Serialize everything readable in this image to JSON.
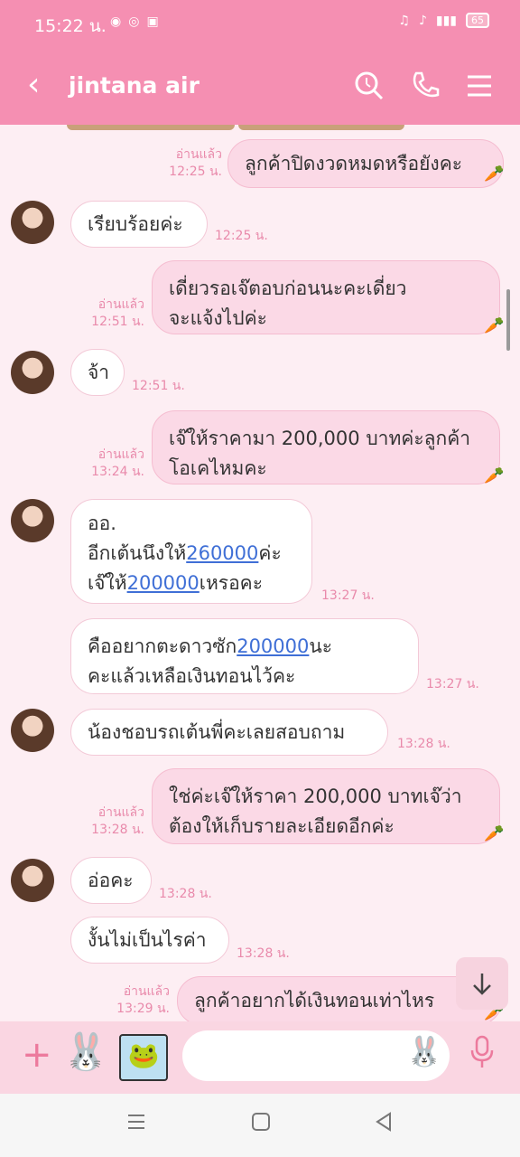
{
  "status": {
    "time": "15:22 น.",
    "battery": "65"
  },
  "header": {
    "back": "‹",
    "title": "jintana air"
  },
  "messages": {
    "m1": {
      "text": "ลูกค้าปิดงวดหมดหรือยังคะ",
      "read": "อ่านแล้ว",
      "time": "12:25 น."
    },
    "m2": {
      "text": "เรียบร้อยค่ะ",
      "time": "12:25 น."
    },
    "m3": {
      "line1": "เดี่ยวรอเจ๊ตอบก่อนนะคะเดี่ยว",
      "line2": "จะแจ้งไปค่ะ",
      "read": "อ่านแล้ว",
      "time": "12:51 น."
    },
    "m4": {
      "text": "จ้า",
      "time": "12:51 น."
    },
    "m5": {
      "line1": "เจ๊ให้ราคามา 200,000 บาทค่ะลูกค้า",
      "line2": "โอเคไหมคะ",
      "read": "อ่านแล้ว",
      "time": "13:24 น."
    },
    "m6": {
      "line1": "ออ.",
      "line2a": "อีกเต้นนึงให้",
      "line2link": "260000",
      "line2b": "ค่ะ",
      "line3a": "เจ๊ให้",
      "line3link": "200000",
      "line3b": "เหรอคะ",
      "time": "13:27 น."
    },
    "m7": {
      "line1a": "คืออยากตะดาวซัก",
      "line1link": "200000",
      "line1b": "นะ",
      "line2": "คะแล้วเหลือเงินทอนไว้คะ",
      "time": "13:27 น."
    },
    "m8": {
      "text": "น้องชอบรถเต้นพี่คะเลยสอบถาม",
      "time": "13:28 น."
    },
    "m9": {
      "line1": "ใช่ค่ะเจ๊ให้ราคา 200,000 บาทเจ๊ว่า",
      "line2": "ต้องให้เก็บรายละเอียดอีกค่ะ",
      "read": "อ่านแล้ว",
      "time": "13:28 น."
    },
    "m10": {
      "text": "อ่อคะ",
      "time": "13:28 น."
    },
    "m11": {
      "text": "งั้นไม่เป็นไรค่า",
      "time": "13:28 น."
    },
    "m12": {
      "text": "ลูกค้าอยากได้เงินทอนเท่าไหร",
      "read": "อ่านแล้ว",
      "time": "13:29 น."
    }
  },
  "input": {
    "placeholder": ""
  },
  "colors": {
    "header": "#f58fb2",
    "chat_bg": "#fdeef3",
    "out_bubble": "#fbd9e6",
    "link": "#3f6fd6"
  }
}
